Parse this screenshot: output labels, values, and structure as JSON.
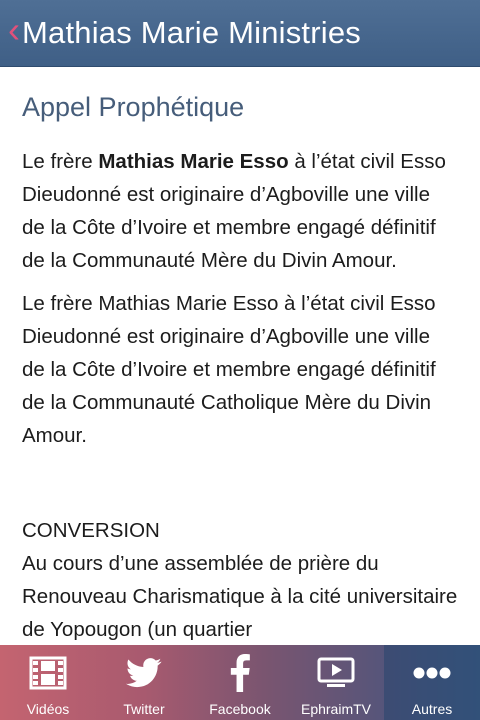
{
  "header": {
    "back_icon": "chevron-left-icon",
    "title": "Mathias Marie Ministries"
  },
  "content": {
    "section_title": "Appel Prophétique",
    "para1_prefix": "Le frère ",
    "para1_bold": "Mathias Marie Esso",
    "para1_rest": " à l’état civil Esso Dieudonné est originaire d’Agboville  une ville de la Côte d’Ivoire et membre engagé définitif de la Communauté Mère du Divin Amour.",
    "para2": "Le frère Mathias Marie Esso à l’état civil Esso Dieudonné est originaire d’Agboville  une ville de la Côte d’Ivoire et membre engagé définitif de la Communauté  Catholique Mère du Divin Amour.",
    "conversion_heading": "CONVERSION",
    "para3": "Au cours d’une assemblée de prière du Renouveau Charismatique à la cité universitaire de Yopougon (un quartier"
  },
  "tabbar": {
    "colors": {
      "active": "#3e5f88",
      "start": "#c46470"
    },
    "tabs": [
      {
        "label": "Vidéos",
        "icon": "film-icon"
      },
      {
        "label": "Twitter",
        "icon": "twitter-bird-icon"
      },
      {
        "label": "Facebook",
        "icon": "facebook-f-icon"
      },
      {
        "label": "EphraimTV",
        "icon": "tv-play-icon"
      },
      {
        "label": "Autres",
        "icon": "more-dots-icon",
        "active": true
      }
    ]
  }
}
